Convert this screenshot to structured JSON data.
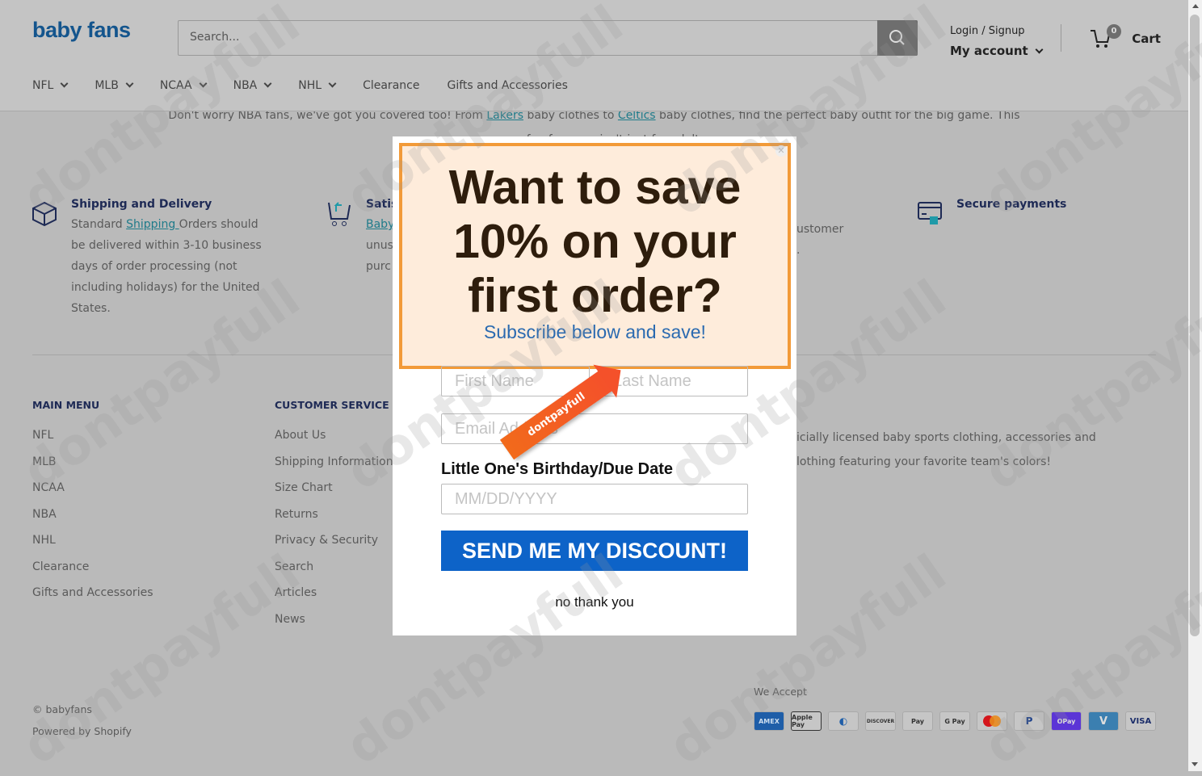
{
  "header": {
    "logo": "baby fans",
    "search_placeholder": "Search...",
    "login": "Login / Signup",
    "account": "My account",
    "cart_label": "Cart",
    "cart_count": "0"
  },
  "nav": [
    "NFL",
    "MLB",
    "NCAA",
    "NBA",
    "NHL",
    "Clearance",
    "Gifts and Accessories"
  ],
  "intro": {
    "line1_a": "Don't worry NBA fans, we've got you covered too! From ",
    "lakers": "Lakers",
    "line1_b": " baby clothes to ",
    "celtics": "Celtics",
    "line1_c": " baby clothes, find the perfect baby outfit for the big game. This",
    "line2": "season, fun fan-gear isn't just for adults."
  },
  "features": [
    {
      "title": "Shipping and Delivery",
      "text_a": "Standard ",
      "link": "Shipping ",
      "text_b": "Orders should be delivered within 3-10 business days of order processing (not including holidays) for the United States."
    },
    {
      "title": "Satis",
      "link": "Baby",
      "line2": "unus",
      "line3": "purc"
    },
    {
      "partial1": "ustomer",
      "partial2": "."
    },
    {
      "title": "Secure payments"
    }
  ],
  "footer": {
    "main_menu_title": "MAIN MENU",
    "main_menu": [
      "NFL",
      "MLB",
      "NCAA",
      "NBA",
      "NHL",
      "Clearance",
      "Gifts and Accessories"
    ],
    "cs_title": "CUSTOMER SERVICE",
    "cs": [
      "About Us",
      "Shipping Information",
      "Size Chart",
      "Returns",
      "Privacy & Security",
      "Search",
      "Articles",
      "News"
    ],
    "about_line1": "icially licensed baby sports clothing, accessories and",
    "about_line2": "lothing featuring your favorite team's colors!",
    "copyright": "© babyfans",
    "powered": "Powered by Shopify",
    "we_accept": "We Accept",
    "payments": [
      "AMEX",
      "Apple Pay",
      "Diners",
      "DISCOVER",
      "Pay",
      "G Pay",
      "Mastercard",
      "PayPal",
      "OPay",
      "Venmo",
      "VISA"
    ]
  },
  "modal": {
    "headline": "Want to save 10% on your first order?",
    "sub": "Subscribe below and save!",
    "first_name": "First Name",
    "last_name": "Last Name",
    "email": "Email Address",
    "date_label": "Little One's Birthday/Due Date",
    "date_placeholder": "MM/DD/YYYY",
    "send": "SEND ME MY DISCOUNT!",
    "no_thanks": "no thank you",
    "badge": "dontpayfull"
  },
  "watermark": "dontpayfull",
  "colors": {
    "accent_orange": "#f29a38",
    "button_blue": "#0d63c8",
    "promo_bg": "#feecdb",
    "navy": "#1e2a55"
  }
}
